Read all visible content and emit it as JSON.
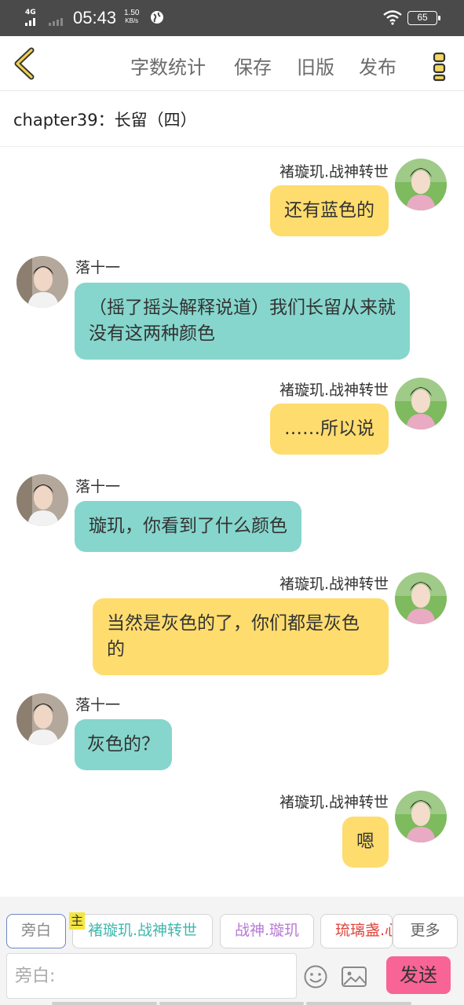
{
  "status_bar": {
    "network": "4G",
    "time": "05:43",
    "speed_value": "1.50",
    "speed_unit": "KB/s",
    "battery": "65"
  },
  "toolbar": {
    "word_count_label": "字数统计",
    "save_label": "保存",
    "old_version_label": "旧版",
    "publish_label": "发布"
  },
  "chapter_title": "chapter39：长留（四）",
  "messages": [
    {
      "side": "right",
      "name": "褚璇玑.战神转世",
      "text": "还有蓝色的"
    },
    {
      "side": "left",
      "name": "落十一",
      "text": "（摇了摇头解释说道）我们长留从来就没有这两种颜色"
    },
    {
      "side": "right",
      "name": "褚璇玑.战神转世",
      "text": "……所以说"
    },
    {
      "side": "left",
      "name": "落十一",
      "text": "璇玑，你看到了什么颜色"
    },
    {
      "side": "right",
      "name": "褚璇玑.战神转世",
      "text": "当然是灰色的了，你们都是灰色的"
    },
    {
      "side": "left",
      "name": "落十一",
      "text": "灰色的？"
    },
    {
      "side": "right",
      "name": "褚璇玑.战神转世",
      "text": "嗯"
    }
  ],
  "roles": {
    "narration_label": "旁白",
    "main_tag": "主",
    "role1_label": "褚璇玑.战神转世",
    "role2_label": "战神.璇玑",
    "role3_label": "琉璃盏.心",
    "more_label": "更多"
  },
  "input": {
    "placeholder": "旁白:"
  },
  "send_label": "发送",
  "colors": {
    "right_bubble": "#fedc6e",
    "left_bubble": "#86d6cd",
    "send_button": "#f86495",
    "toolbar_icon": "#c8a534"
  },
  "icons": {
    "back": "chevron-left-icon",
    "more": "vertical-dots-icon",
    "emoji": "smiley-icon",
    "image": "image-icon"
  }
}
